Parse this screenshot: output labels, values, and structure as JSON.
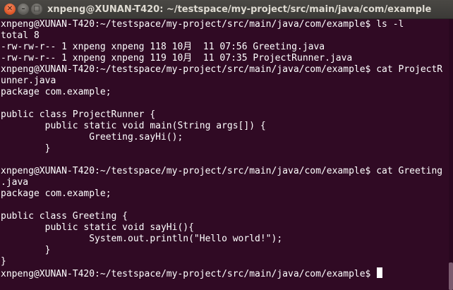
{
  "window": {
    "title": "xnpeng@XUNAN-T420: ~/testspace/my-project/src/main/java/com/example",
    "close_glyph": "✕",
    "minimize_glyph": "–",
    "maximize_glyph": "□"
  },
  "terminal": {
    "lines": [
      "xnpeng@XUNAN-T420:~/testspace/my-project/src/main/java/com/example$ ls -l",
      "total 8",
      "-rw-rw-r-- 1 xnpeng xnpeng 118 10月  11 07:56 Greeting.java",
      "-rw-rw-r-- 1 xnpeng xnpeng 119 10月  11 07:35 ProjectRunner.java",
      "xnpeng@XUNAN-T420:~/testspace/my-project/src/main/java/com/example$ cat ProjectR",
      "unner.java",
      "package com.example;",
      "",
      "public class ProjectRunner {",
      "        public static void main(String args[]) {",
      "                Greeting.sayHi();",
      "        }",
      "",
      "xnpeng@XUNAN-T420:~/testspace/my-project/src/main/java/com/example$ cat Greeting",
      ".java",
      "package com.example;",
      "",
      "public class Greeting {",
      "        public static void sayHi(){",
      "                System.out.println(\"Hello world!\");",
      "        }",
      "}",
      "xnpeng@XUNAN-T420:~/testspace/my-project/src/main/java/com/example$ "
    ]
  },
  "colors": {
    "background": "#300a24",
    "text": "#ffffff",
    "close_button": "#e05a2b"
  }
}
